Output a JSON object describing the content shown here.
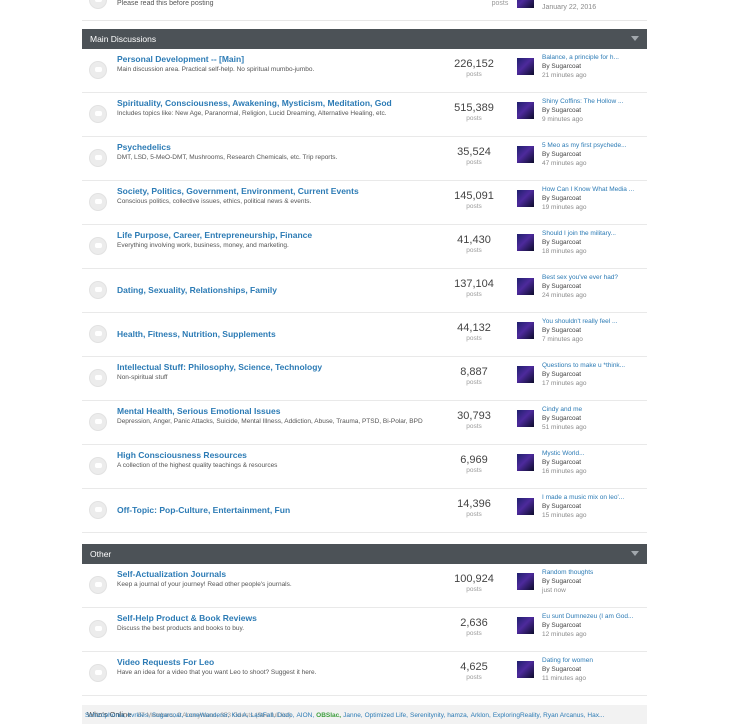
{
  "top_row": {
    "description": "Please read this before posting",
    "count_label": "posts",
    "last_post_date": "January 22, 2016"
  },
  "categories": [
    {
      "title": "Main Discussions",
      "forums": [
        {
          "title": "Personal Development -- [Main]",
          "description": "Main discussion area. Practical self-help. No spiritual mumbo-jumbo.",
          "count": "226,152",
          "count_label": "posts",
          "lp_title": "Balance, a principle for h...",
          "lp_by": "By Sugarcoat",
          "lp_time": "21 minutes ago"
        },
        {
          "title": "Spirituality, Consciousness, Awakening, Mysticism, Meditation, God",
          "description": "Includes topics like: New Age, Paranormal, Religion, Lucid Dreaming, Alternative Healing, etc.",
          "count": "515,389",
          "count_label": "posts",
          "lp_title": "Shiny Coffins: The Hollow ...",
          "lp_by": "By Sugarcoat",
          "lp_time": "9 minutes ago"
        },
        {
          "title": "Psychedelics",
          "description": "DMT, LSD, 5-MeO-DMT, Mushrooms, Research Chemicals, etc. Trip reports.",
          "count": "35,524",
          "count_label": "posts",
          "lp_title": "5 Meo as my first psychede...",
          "lp_by": "By Sugarcoat",
          "lp_time": "47 minutes ago"
        },
        {
          "title": "Society, Politics, Government, Environment, Current Events",
          "description": "Conscious politics, collective issues, ethics, political news & events.",
          "count": "145,091",
          "count_label": "posts",
          "lp_title": "How Can I Know What Media ...",
          "lp_by": "By Sugarcoat",
          "lp_time": "19 minutes ago"
        },
        {
          "title": "Life Purpose, Career, Entrepreneurship, Finance",
          "description": "Everything involving work, business, money, and marketing.",
          "count": "41,430",
          "count_label": "posts",
          "lp_title": "Should I join the military...",
          "lp_by": "By Sugarcoat",
          "lp_time": "18 minutes ago"
        },
        {
          "title": "Dating, Sexuality, Relationships, Family",
          "description": "",
          "count": "137,104",
          "count_label": "posts",
          "lp_title": "Best sex you've ever had?",
          "lp_by": "By Sugarcoat",
          "lp_time": "24 minutes ago"
        },
        {
          "title": "Health, Fitness, Nutrition, Supplements",
          "description": "",
          "count": "44,132",
          "count_label": "posts",
          "lp_title": "You shouldn't really feel ...",
          "lp_by": "By Sugarcoat",
          "lp_time": "7 minutes ago"
        },
        {
          "title": "Intellectual Stuff: Philosophy, Science, Technology",
          "description": "Non-spiritual stuff",
          "count": "8,887",
          "count_label": "posts",
          "lp_title": "Questions to make u *think...",
          "lp_by": "By Sugarcoat",
          "lp_time": "17 minutes ago"
        },
        {
          "title": "Mental Health, Serious Emotional Issues",
          "description": "Depression, Anger, Panic Attacks, Suicide, Mental Illness, Addiction, Abuse, Trauma, PTSD, Bi-Polar, BPD",
          "count": "30,793",
          "count_label": "posts",
          "lp_title": "Cindy and me",
          "lp_by": "By Sugarcoat",
          "lp_time": "51 minutes ago"
        },
        {
          "title": "High Consciousness Resources",
          "description": "A collection of the highest quality teachings & resources",
          "count": "6,969",
          "count_label": "posts",
          "lp_title": "Mystic World...",
          "lp_by": "By Sugarcoat",
          "lp_time": "16 minutes ago"
        },
        {
          "title": "Off-Topic: Pop-Culture, Entertainment, Fun",
          "description": "",
          "count": "14,396",
          "count_label": "posts",
          "lp_title": "I made a music mix on leo'...",
          "lp_by": "By Sugarcoat",
          "lp_time": "15 minutes ago"
        }
      ]
    },
    {
      "title": "Other",
      "forums": [
        {
          "title": "Self-Actualization Journals",
          "description": "Keep a journal of your journey! Read other people's journals.",
          "count": "100,924",
          "count_label": "posts",
          "lp_title": "Random thoughts",
          "lp_by": "By Sugarcoat",
          "lp_time": "just now"
        },
        {
          "title": "Self-Help Product & Book Reviews",
          "description": "Discuss the best products and books to buy.",
          "count": "2,636",
          "count_label": "posts",
          "lp_title": "Eu sunt Dumnezeu (I am God...",
          "lp_by": "By Sugarcoat",
          "lp_time": "12 minutes ago"
        },
        {
          "title": "Video Requests For Leo",
          "description": "Have an idea for a video that you want Leo to shoot? Suggest it here.",
          "count": "4,625",
          "count_label": "posts",
          "lp_title": "Dating for women",
          "lp_by": "By Sugarcoat",
          "lp_time": "11 minutes ago"
        }
      ]
    }
  ],
  "online": {
    "heading": "Who's Online",
    "summary": "37 Members, 0 Anonymous, 353 Guests (See full list)",
    "names": [
      "Schizophonia,",
      "kvrkles,",
      "Sugarcoat,",
      "LoneWanderer,",
      "Kid A,",
      "LastFall,",
      "Dodo,",
      "AION,",
      "OBSIac,",
      "Janne,",
      "Optimized Life,",
      "Serenitynity,",
      "hamza,",
      "Arklon,",
      "ExploringReality,",
      "Ryan Arcanus,",
      "Hax..."
    ],
    "highlight_name": "OBSIac,"
  }
}
